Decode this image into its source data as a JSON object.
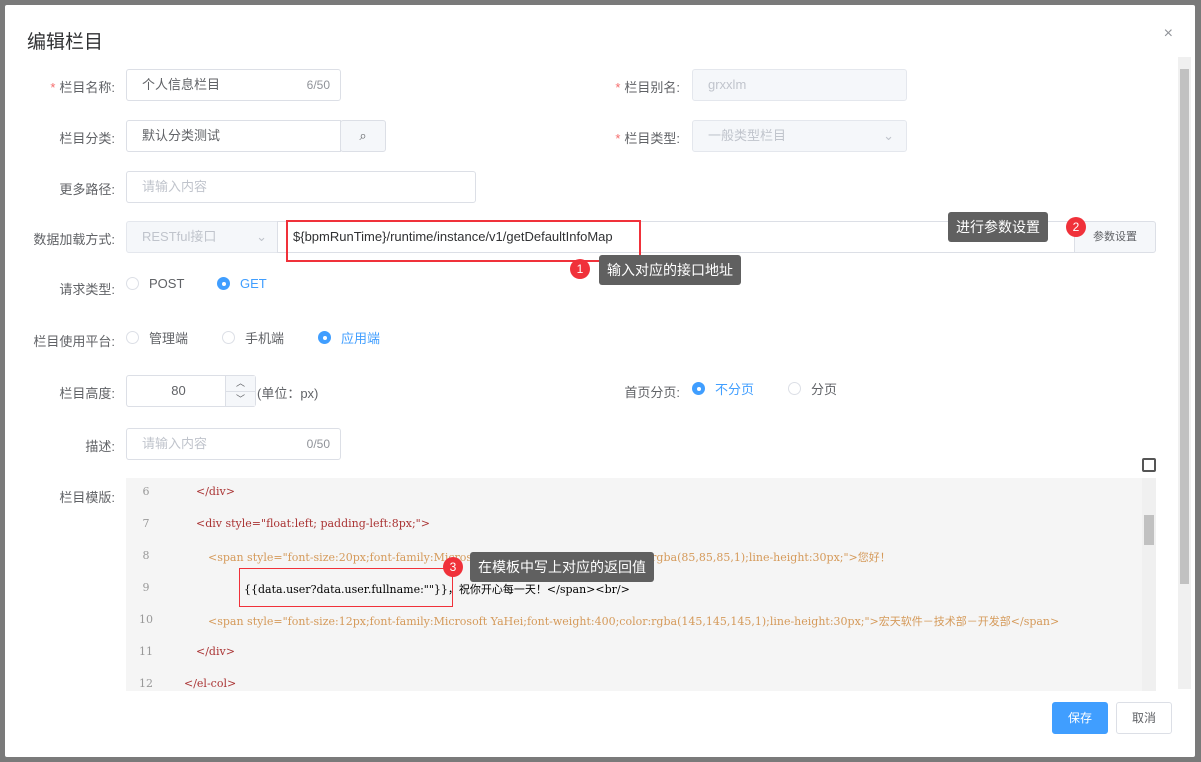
{
  "dialog": {
    "title": "编辑栏目",
    "close": "×"
  },
  "form": {
    "name": {
      "label": "栏目名称:",
      "value": "个人信息栏目",
      "count": "6/50"
    },
    "alias": {
      "label": "栏目别名:",
      "value": "grxxlm"
    },
    "category": {
      "label": "栏目分类:",
      "value": "默认分类测试"
    },
    "type": {
      "label": "栏目类型:",
      "value": "一般类型栏目"
    },
    "more_path": {
      "label": "更多路径:",
      "placeholder": "请输入内容"
    },
    "load_method": {
      "label": "数据加载方式:",
      "select": "RESTful接口",
      "url": "${bpmRunTime}/runtime/instance/v1/getDefaultInfoMap",
      "param_button": "参数设置"
    },
    "request_type": {
      "label": "请求类型:",
      "options": [
        "POST",
        "GET"
      ],
      "selected": "GET"
    },
    "platform": {
      "label": "栏目使用平台:",
      "options": [
        "管理端",
        "手机端",
        "应用端"
      ],
      "selected": "应用端"
    },
    "height": {
      "label": "栏目高度:",
      "value": "80",
      "unit": "(单位：px)"
    },
    "paging": {
      "label": "首页分页:",
      "options": [
        "不分页",
        "分页"
      ],
      "selected": "不分页"
    },
    "desc": {
      "label": "描述:",
      "placeholder": "请输入内容",
      "count": "0/50"
    },
    "template": {
      "label": "栏目模版:"
    }
  },
  "code": [
    {
      "n": "6",
      "t": "</div>"
    },
    {
      "n": "7",
      "t": "<div style=\"float:left; padding-left:8px;\">"
    },
    {
      "n": "8",
      "t": "<span style=\"font-size:20px;font-family:Microsoft YaHei;font-weight:400;color:rgba(85,85,85,1);line-height:30px;\">您好！"
    },
    {
      "n": "9",
      "t": "{{data.user?data.user.fullname:\"\"}}，祝你开心每一天！</span><br/>"
    },
    {
      "n": "10",
      "t": "<span style=\"font-size:12px;font-family:Microsoft YaHei;font-weight:400;color:rgba(145,145,145,1);line-height:30px;\">宏天软件－技术部－开发部</span>"
    },
    {
      "n": "11",
      "t": "</div>"
    },
    {
      "n": "12",
      "t": "</el-col>"
    }
  ],
  "annotations": [
    {
      "num": "1",
      "text": "输入对应的接口地址"
    },
    {
      "num": "2",
      "text": "进行参数设置"
    },
    {
      "num": "3",
      "text": "在模板中写上对应的返回值"
    }
  ],
  "footer": {
    "save": "保存",
    "cancel": "取消"
  }
}
